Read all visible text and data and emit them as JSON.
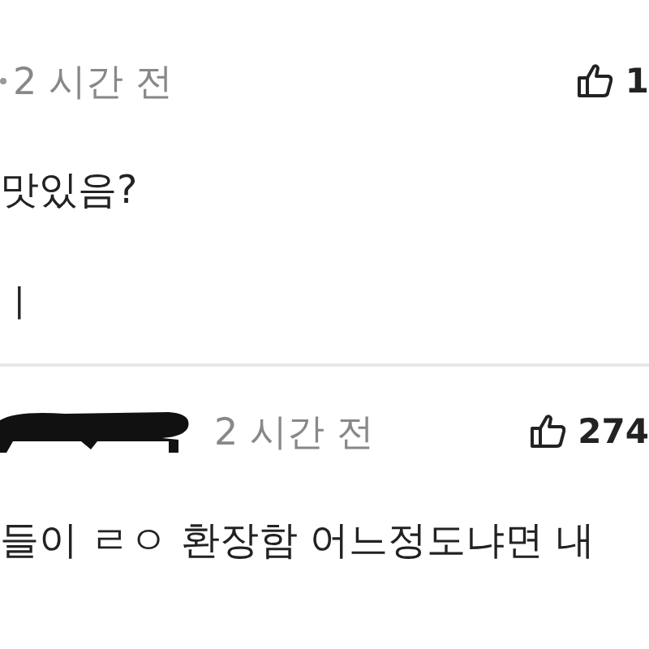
{
  "comments": [
    {
      "author_redacted": false,
      "time": "2 시간 전",
      "likes": "1",
      "lines": [
        "맛있음?",
        "ㅣ"
      ]
    },
    {
      "author_redacted": true,
      "time": "2 시간 전",
      "likes": "274",
      "lines": [
        "들이 ㄹㅇ 환장함 어느정도냐면 내"
      ]
    }
  ]
}
